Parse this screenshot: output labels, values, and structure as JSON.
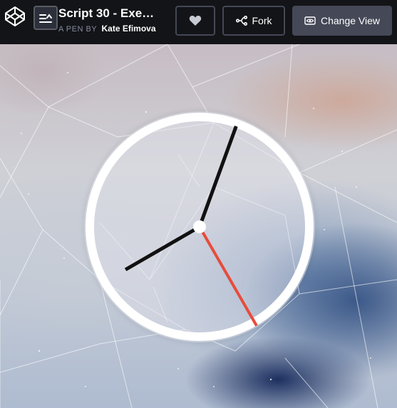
{
  "header": {
    "logo_icon": "codepen-logo",
    "menu_icon": "pen-details-toggle-icon",
    "title": "Script 30 - Exe…",
    "pen_by_label": "A PEN BY",
    "author": "Kate Efimova",
    "heart_icon": "heart-icon",
    "fork_label": "Fork",
    "fork_icon": "fork-icon",
    "change_view_label": "Change View",
    "change_view_icon": "eye-icon"
  },
  "clock": {
    "hour_hand_degrees": 240,
    "minute_hand_degrees": 20,
    "second_hand_degrees": 150,
    "colors": {
      "face_border": "#ffffff",
      "hour_hand": "#111111",
      "minute_hand": "#111111",
      "second_hand": "#e74c3c",
      "center": "#ffffff"
    }
  },
  "colors": {
    "topbar_bg": "#131417",
    "button_border": "#444857",
    "change_view_bg": "#444857",
    "text_primary": "#ffffff",
    "text_muted": "#868ca0"
  }
}
